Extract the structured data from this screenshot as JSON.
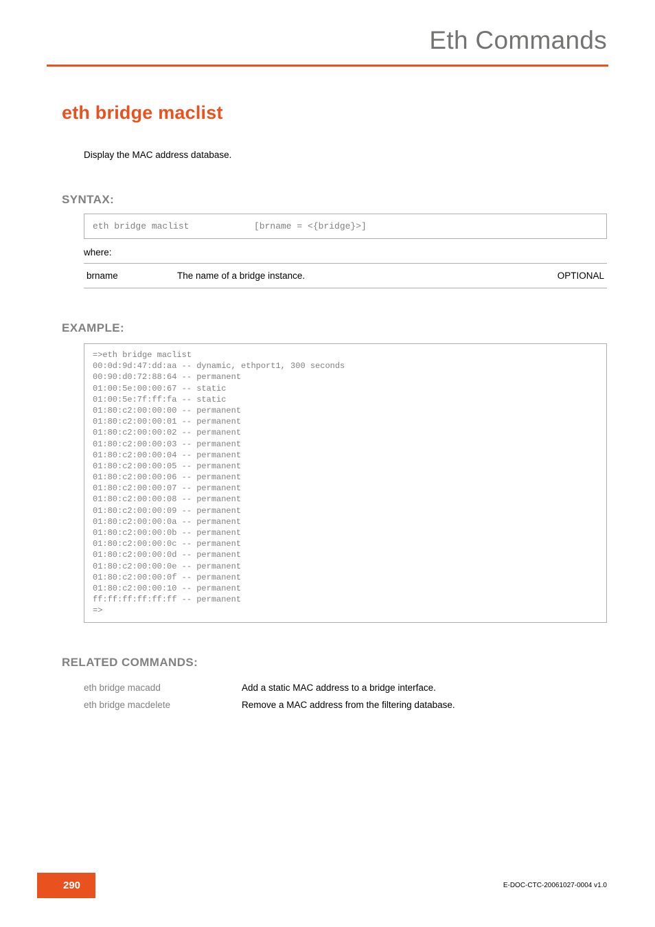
{
  "header": {
    "chapter": "Eth Commands"
  },
  "command": {
    "title": "eth bridge maclist",
    "description": "Display the MAC address database."
  },
  "syntax": {
    "heading": "SYNTAX:",
    "cmd": "eth bridge maclist",
    "args": "[brname = <{bridge}>]",
    "where": "where:",
    "params": [
      {
        "name": "brname",
        "desc": "The name of  a bridge instance.",
        "opt": "OPTIONAL"
      }
    ]
  },
  "example": {
    "heading": "EXAMPLE:",
    "body": "=>eth bridge maclist\n00:0d:9d:47:dd:aa -- dynamic, ethport1, 300 seconds\n00:90:d0:72:88:64 -- permanent\n01:00:5e:00:00:67 -- static\n01:00:5e:7f:ff:fa -- static\n01:80:c2:00:00:00 -- permanent\n01:80:c2:00:00:01 -- permanent\n01:80:c2:00:00:02 -- permanent\n01:80:c2:00:00:03 -- permanent\n01:80:c2:00:00:04 -- permanent\n01:80:c2:00:00:05 -- permanent\n01:80:c2:00:00:06 -- permanent\n01:80:c2:00:00:07 -- permanent\n01:80:c2:00:00:08 -- permanent\n01:80:c2:00:00:09 -- permanent\n01:80:c2:00:00:0a -- permanent\n01:80:c2:00:00:0b -- permanent\n01:80:c2:00:00:0c -- permanent\n01:80:c2:00:00:0d -- permanent\n01:80:c2:00:00:0e -- permanent\n01:80:c2:00:00:0f -- permanent\n01:80:c2:00:00:10 -- permanent\nff:ff:ff:ff:ff:ff -- permanent\n=>"
  },
  "related": {
    "heading": "RELATED COMMANDS:",
    "rows": [
      {
        "cmd": "eth bridge macadd",
        "desc": "Add a static MAC address to a bridge interface."
      },
      {
        "cmd": "eth bridge macdelete",
        "desc": "Remove a MAC address from the filtering database."
      }
    ]
  },
  "footer": {
    "page": "290",
    "docid": "E-DOC-CTC-20061027-0004 v1.0"
  }
}
